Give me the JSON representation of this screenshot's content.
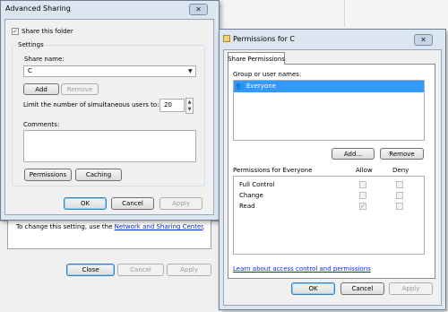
{
  "background_window": {
    "partial_letter": "a",
    "info_text_prefix": "To change this setting, use the ",
    "info_link": "Network and Sharing Center",
    "info_text_suffix": ".",
    "buttons": {
      "close": "Close",
      "cancel": "Cancel",
      "apply": "Apply"
    }
  },
  "advanced_sharing": {
    "title": "Advanced Sharing",
    "share_checkbox_label": "Share this folder",
    "share_checked": true,
    "settings_label": "Settings",
    "share_name_label": "Share name:",
    "share_name_value": "C",
    "add_label": "Add",
    "remove_label": "Remove",
    "limit_label": "Limit the number of simultaneous users to:",
    "limit_value": "20",
    "comments_label": "Comments:",
    "permissions_label": "Permissions",
    "caching_label": "Caching",
    "ok_label": "OK",
    "cancel_label": "Cancel",
    "apply_label": "Apply"
  },
  "permissions_dialog": {
    "title": "Permissions for C",
    "tab_label": "Share Permissions",
    "group_label": "Group or user names:",
    "users": [
      "Everyone"
    ],
    "add_label": "Add...",
    "remove_label": "Remove",
    "permissions_for_label": "Permissions for Everyone",
    "allow_header": "Allow",
    "deny_header": "Deny",
    "rows": [
      {
        "name": "Full Control",
        "allow": false,
        "deny": false
      },
      {
        "name": "Change",
        "allow": false,
        "deny": false
      },
      {
        "name": "Read",
        "allow": true,
        "deny": false
      }
    ],
    "learn_link": "Learn about access control and permissions",
    "ok_label": "OK",
    "cancel_label": "Cancel",
    "apply_label": "Apply"
  },
  "icons": {
    "close": "close-icon",
    "users": "users-icon",
    "check": "checkmark-icon"
  },
  "colors": {
    "selection": "#3399ff",
    "link": "#0033cc",
    "window_frame": "#dce6f0"
  }
}
